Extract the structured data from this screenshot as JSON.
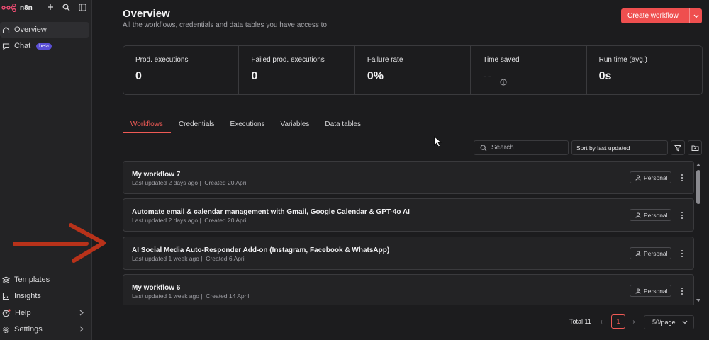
{
  "app": {
    "name": "n8n"
  },
  "sidebar": {
    "items": [
      {
        "label": "Overview",
        "icon": "home-icon",
        "active": true
      },
      {
        "label": "Chat",
        "icon": "chat-icon",
        "badge": "beta"
      }
    ],
    "bottom_items": [
      {
        "label": "Templates",
        "icon": "templates-icon"
      },
      {
        "label": "Insights",
        "icon": "insights-icon"
      },
      {
        "label": "Help",
        "icon": "help-icon",
        "has_submenu": true
      },
      {
        "label": "Settings",
        "icon": "gear-icon",
        "has_submenu": true
      }
    ]
  },
  "header": {
    "title": "Overview",
    "subtitle": "All the workflows, credentials and data tables you have access to",
    "create_label": "Create workflow"
  },
  "stats": [
    {
      "label": "Prod. executions",
      "value": "0"
    },
    {
      "label": "Failed prod. executions",
      "value": "0"
    },
    {
      "label": "Failure rate",
      "value": "0%"
    },
    {
      "label": "Time saved",
      "value": "--"
    },
    {
      "label": "Run time (avg.)",
      "value": "0s"
    }
  ],
  "tabs": [
    "Workflows",
    "Credentials",
    "Executions",
    "Variables",
    "Data tables"
  ],
  "active_tab": "Workflows",
  "toolbar": {
    "search_placeholder": "Search",
    "sort_label": "Sort by last updated"
  },
  "workflows": [
    {
      "name": "My workflow 7",
      "updated": "Last updated 2 days ago",
      "created": "Created 20 April",
      "owner": "Personal"
    },
    {
      "name": "Automate email & calendar management with Gmail, Google Calendar & GPT-4o AI",
      "updated": "Last updated 2 days ago",
      "created": "Created 20 April",
      "owner": "Personal"
    },
    {
      "name": "AI Social Media Auto-Responder Add-on (Instagram, Facebook & WhatsApp)",
      "updated": "Last updated 1 week ago",
      "created": "Created 6 April",
      "owner": "Personal"
    },
    {
      "name": "My workflow 6",
      "updated": "Last updated 1 week ago",
      "created": "Created 14 April",
      "owner": "Personal"
    }
  ],
  "pagination": {
    "total_label": "Total 11",
    "current_page": "1",
    "per_page": "50/page"
  },
  "colors": {
    "accent": "#ef4f4f",
    "annotation_arrow": "#b8321a",
    "background": "#1c1c1e"
  }
}
